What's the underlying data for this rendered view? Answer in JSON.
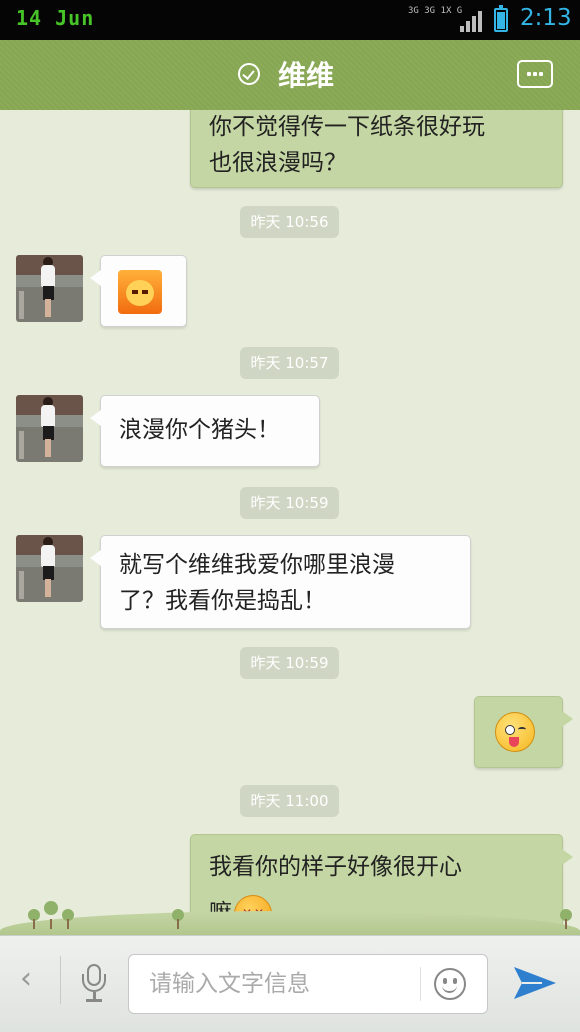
{
  "status_bar": {
    "date": "14 Jun",
    "network_1": "3G",
    "network_2": "3G 1X",
    "network_3": "G",
    "time": "2:13",
    "battery_level": 0.95,
    "accent_color": "#33b5e5",
    "date_color": "#47c427"
  },
  "header": {
    "title": "维维",
    "verified_icon": "check-circle-icon",
    "menu_icon": "more-icon",
    "bar_color": "#8bab58"
  },
  "messages": [
    {
      "type": "text",
      "side": "out",
      "lines": [
        "你不觉得传一下纸条很好玩",
        "也很浪漫吗？"
      ]
    },
    {
      "type": "time",
      "text": "昨天 10:56"
    },
    {
      "type": "emoji",
      "side": "in",
      "emoji": "fire-angry-emoticon"
    },
    {
      "type": "time",
      "text": "昨天 10:57"
    },
    {
      "type": "text",
      "side": "in",
      "lines": [
        "浪漫你个猪头！"
      ]
    },
    {
      "type": "time",
      "text": "昨天 10:59"
    },
    {
      "type": "text",
      "side": "in",
      "lines": [
        "就写个维维我爱你哪里浪漫",
        "了？我看你是捣乱！"
      ]
    },
    {
      "type": "time",
      "text": "昨天 10:59"
    },
    {
      "type": "emoji",
      "side": "out",
      "emoji": "wink-tongue-emoticon"
    },
    {
      "type": "time",
      "text": "昨天 11:00"
    },
    {
      "type": "text",
      "side": "out",
      "lines": [
        "我看你的样子好像很开心",
        "嘛"
      ],
      "trailing_emoji": "blush-emoticon"
    }
  ],
  "input_bar": {
    "placeholder": "请输入文字信息",
    "back_icon": "chevron-left-icon",
    "voice_icon": "microphone-icon",
    "emoji_icon": "smiley-icon",
    "send_icon": "send-icon",
    "send_color": "#2f7fcf"
  }
}
